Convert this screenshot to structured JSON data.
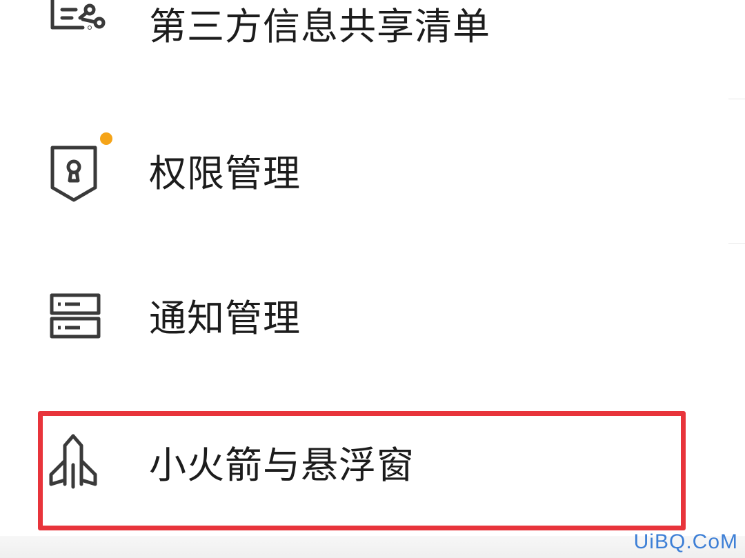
{
  "menu": {
    "items": [
      {
        "label": "第三方信息共享清单",
        "icon": "document-share-icon"
      },
      {
        "label": "权限管理",
        "icon": "shield-lock-icon",
        "badge": true
      },
      {
        "label": "通知管理",
        "icon": "notification-list-icon"
      },
      {
        "label": "小火箭与悬浮窗",
        "icon": "rocket-icon",
        "highlighted": true
      }
    ]
  },
  "colors": {
    "highlight": "#e8343b",
    "badge": "#f5a418",
    "icon_stroke": "#3a3a3a",
    "text": "#1c1c1c",
    "watermark": "#3d7fd6"
  },
  "watermark": {
    "text": "UiBQ.CoM"
  }
}
